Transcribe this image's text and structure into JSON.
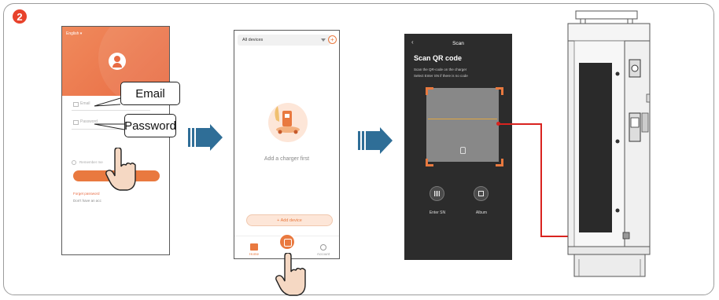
{
  "step": {
    "number": "2"
  },
  "login_screen": {
    "language": "English",
    "email_placeholder": "Email",
    "password_placeholder": "Password",
    "remember_me": "Remember me",
    "login_button": "Log in",
    "forgot_password": "Forget password",
    "no_account": "Don't have an acc"
  },
  "callouts": {
    "email": "Email",
    "password": "Password"
  },
  "devices_screen": {
    "selector": "All devices",
    "empty_text": "Add a charger first",
    "add_device_button": "+ Add device",
    "nav": [
      {
        "label": "Home"
      },
      {
        "label": "Account"
      }
    ]
  },
  "scan_screen": {
    "back": "‹",
    "title": "Scan",
    "heading": "Scan QR code",
    "instruction_1": "Scan the QR-code on the charger",
    "instruction_2": "Select Enter SN if there is no code",
    "enter_sn_label": "Enter SN",
    "album_label": "Album"
  },
  "colors": {
    "accent": "#e9793f",
    "arrow": "#2f6e97",
    "indicator": "#d9231f"
  }
}
